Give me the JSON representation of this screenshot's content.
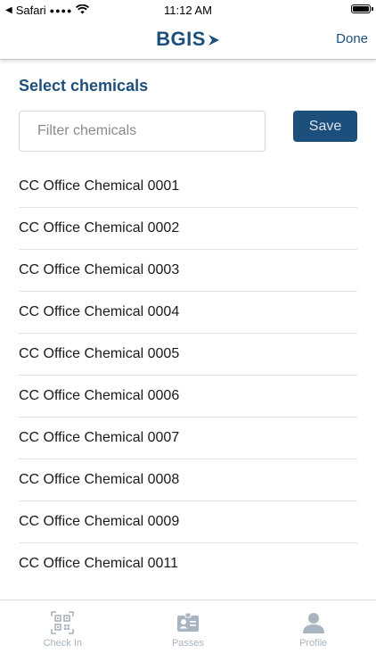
{
  "status_bar": {
    "back_app": "Safari",
    "time": "11:12 AM"
  },
  "nav": {
    "logo_text": "BGIS",
    "done_label": "Done"
  },
  "page": {
    "title": "Select chemicals",
    "filter_placeholder": "Filter chemicals",
    "filter_value": "",
    "save_label": "Save"
  },
  "chemicals": [
    "CC Office Chemical 0001",
    "CC Office Chemical 0002",
    "CC Office Chemical 0003",
    "CC Office Chemical 0004",
    "CC Office Chemical 0005",
    "CC Office Chemical 0006",
    "CC Office Chemical 0007",
    "CC Office Chemical 0008",
    "CC Office Chemical 0009",
    "CC Office Chemical 0011"
  ],
  "tabs": [
    {
      "label": "Check In",
      "icon": "qr-code-icon"
    },
    {
      "label": "Passes",
      "icon": "id-badge-icon"
    },
    {
      "label": "Profile",
      "icon": "person-icon"
    }
  ],
  "colors": {
    "brand": "#1d4f7c",
    "tab_inactive": "#a8b4c0",
    "divider": "#e3e3e3"
  }
}
